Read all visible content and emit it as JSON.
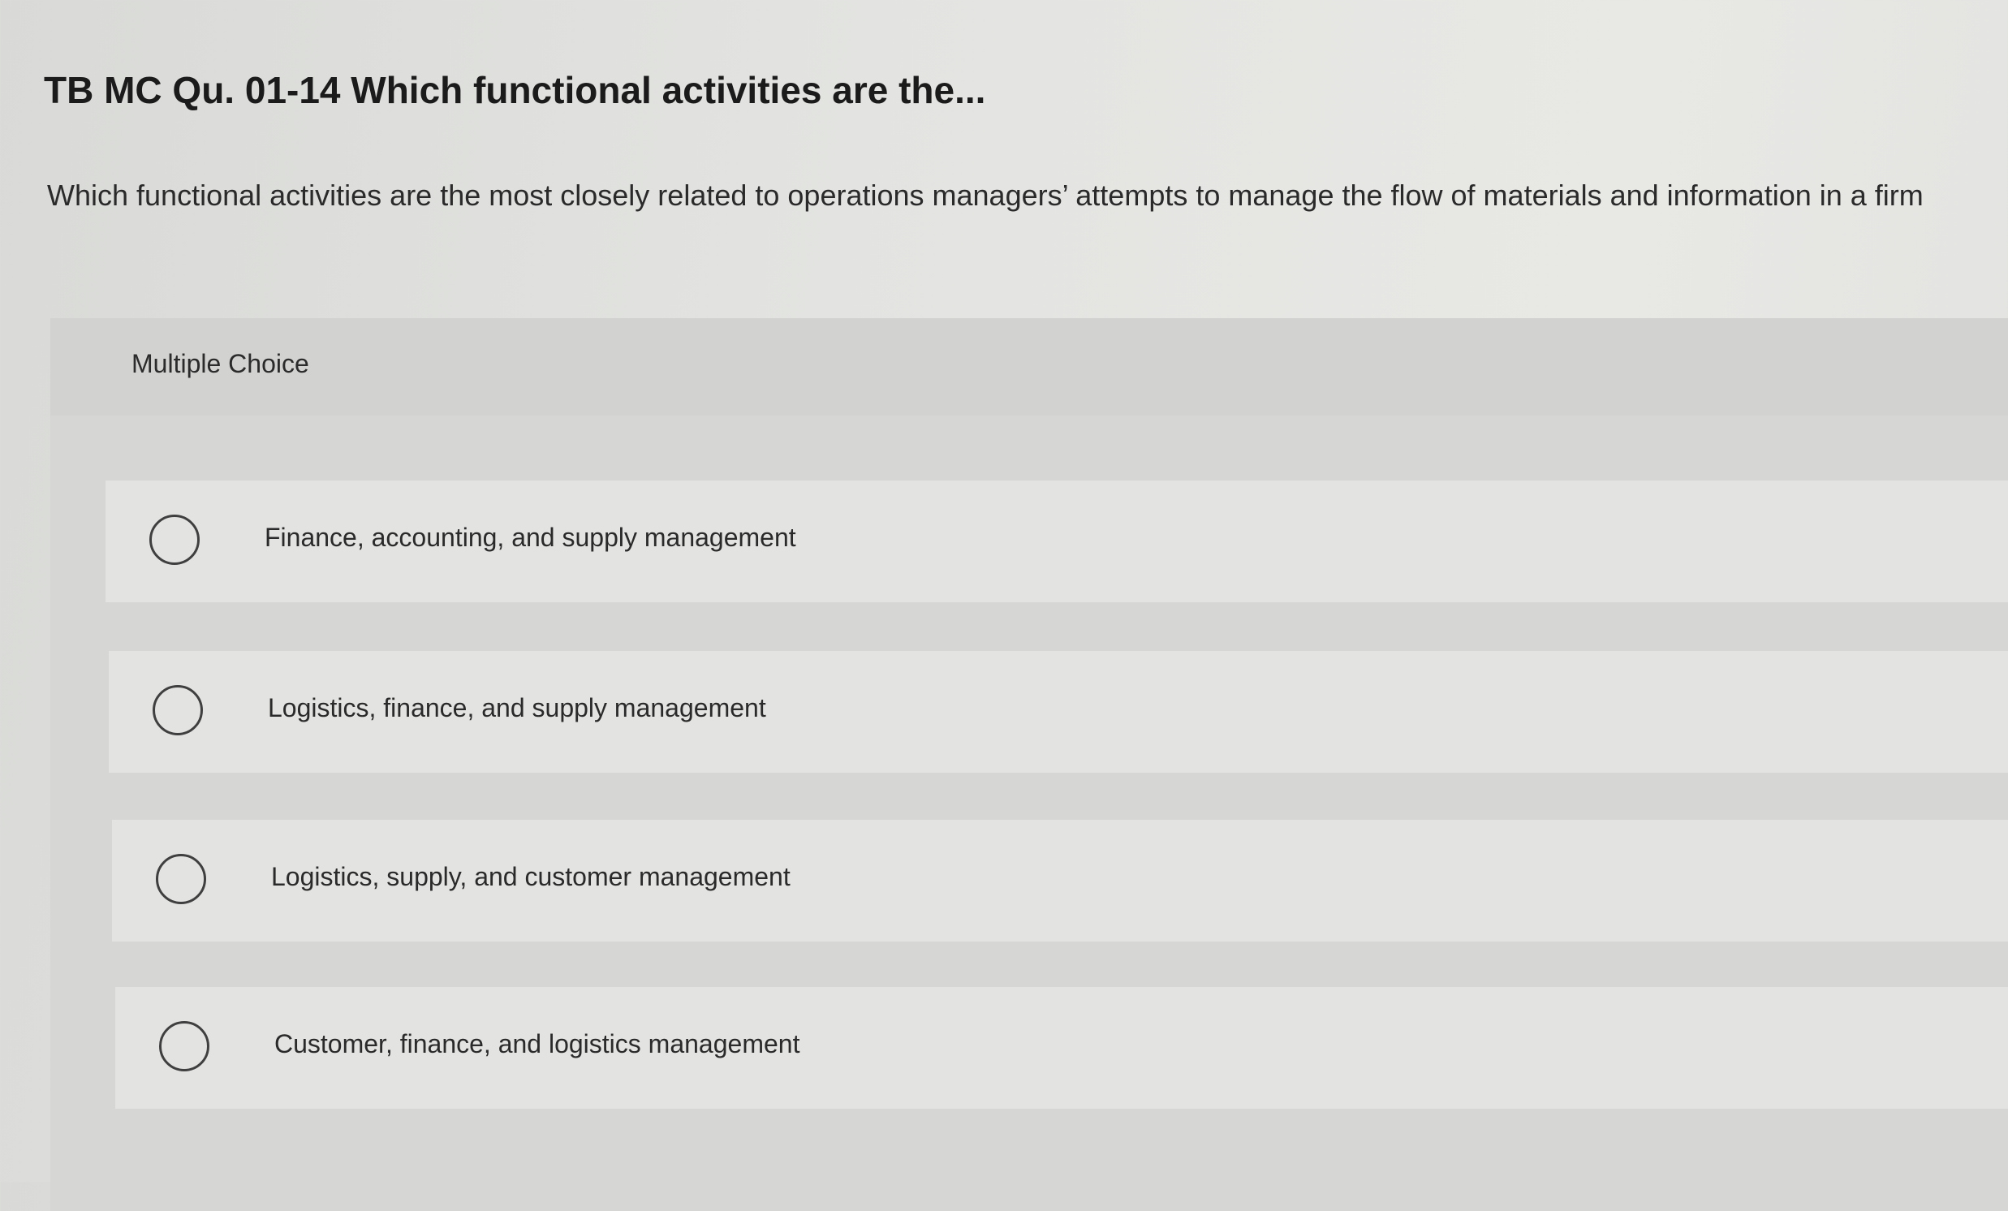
{
  "question": {
    "title": "TB MC Qu. 01-14 Which functional activities are the...",
    "prompt": "Which functional activities are the most closely related to operations managers’ attempts to manage the flow of materials and information in a firm"
  },
  "choice_panel": {
    "type_label": "Multiple Choice",
    "options": [
      {
        "label": "Finance, accounting, and supply management",
        "selected": false
      },
      {
        "label": "Logistics, finance, and supply management",
        "selected": false
      },
      {
        "label": "Logistics, supply, and customer management",
        "selected": false
      },
      {
        "label": "Customer, finance, and logistics management",
        "selected": false
      }
    ]
  },
  "colors": {
    "background": "#e3e4e1",
    "panel": "#d6d7d4",
    "text": "#1e1e1e"
  }
}
